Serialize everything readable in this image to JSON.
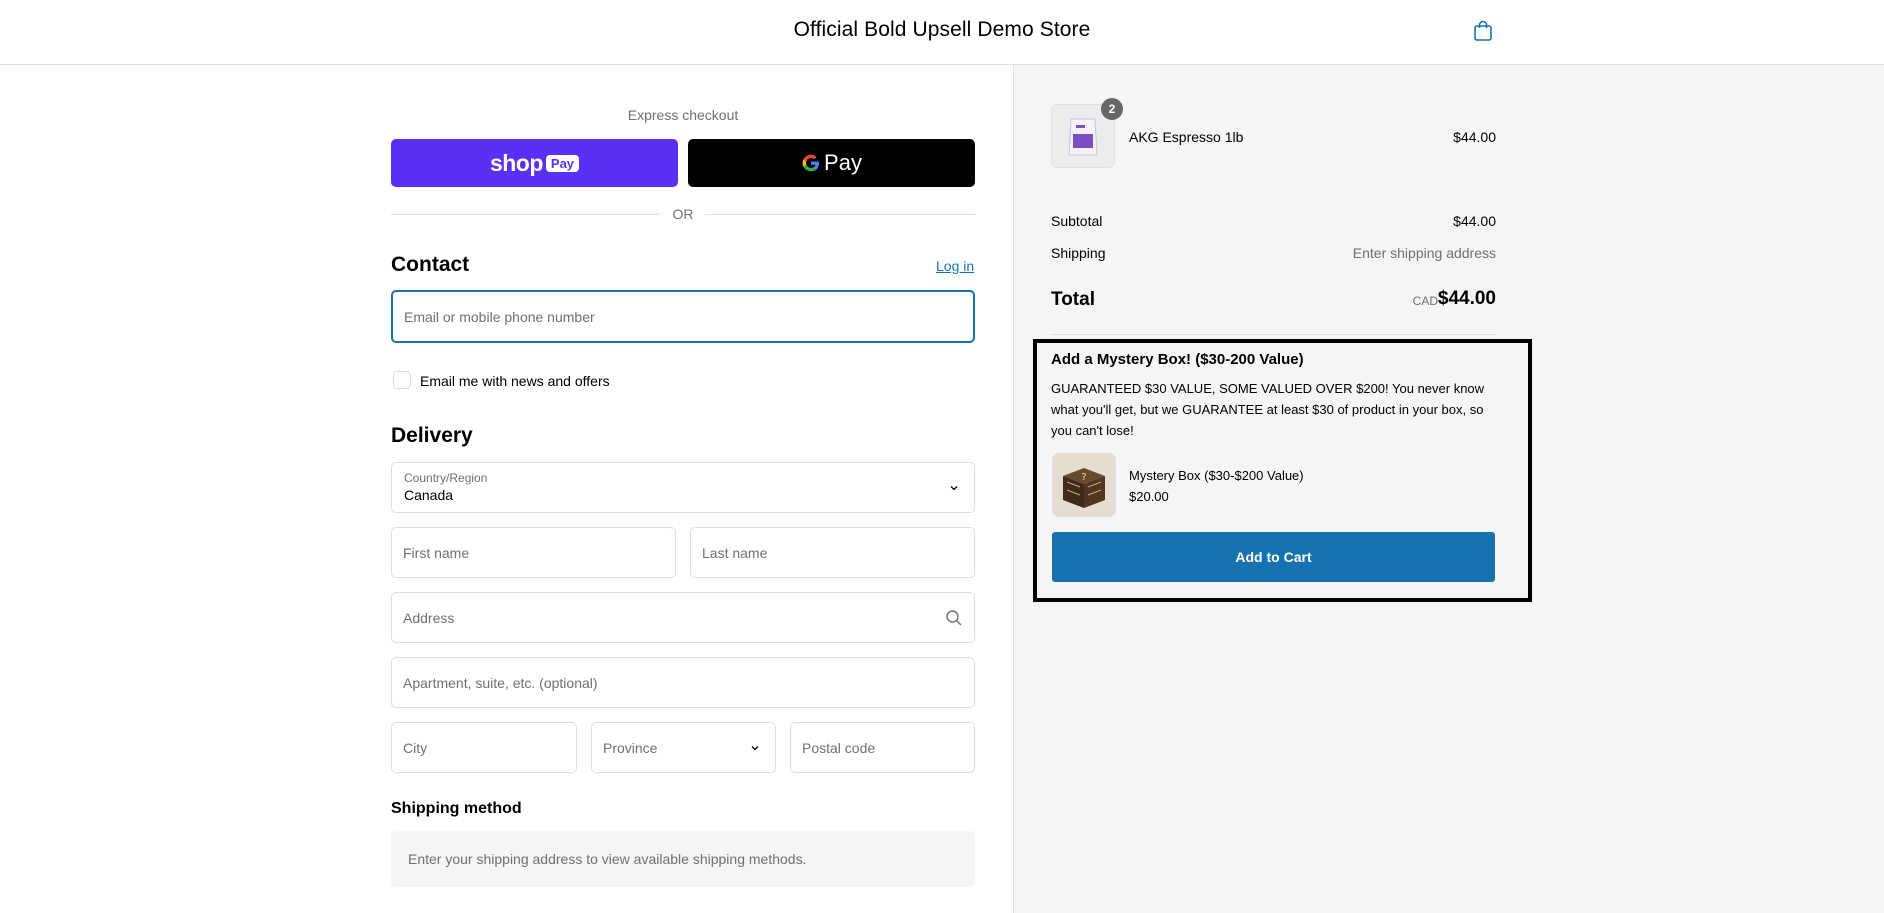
{
  "header": {
    "store_title": "Official Bold Upsell Demo Store",
    "cart_icon": "shopping-bag-icon"
  },
  "express": {
    "label": "Express checkout",
    "shoppay_text": "shop",
    "shoppay_pill": "Pay",
    "gpay_text": "Pay",
    "or_text": "OR"
  },
  "contact": {
    "title": "Contact",
    "login_link": "Log in",
    "email_placeholder": "Email or mobile phone number",
    "news_checkbox_label": "Email me with news and offers"
  },
  "delivery": {
    "title": "Delivery",
    "country_label": "Country/Region",
    "country_value": "Canada",
    "first_name_placeholder": "First name",
    "last_name_placeholder": "Last name",
    "address_placeholder": "Address",
    "apartment_placeholder": "Apartment, suite, etc. (optional)",
    "city_placeholder": "City",
    "province_placeholder": "Province",
    "postal_placeholder": "Postal code"
  },
  "shipping_method": {
    "title": "Shipping method",
    "info": "Enter your shipping address to view available shipping methods."
  },
  "order": {
    "item": {
      "name": "AKG Espresso 1lb",
      "price": "$44.00",
      "quantity": "2"
    },
    "subtotal_label": "Subtotal",
    "subtotal_value": "$44.00",
    "shipping_label": "Shipping",
    "shipping_value": "Enter shipping address",
    "total_label": "Total",
    "total_currency": "CAD",
    "total_value": "$44.00"
  },
  "upsell": {
    "title": "Add a Mystery Box! ($30-200 Value)",
    "description": "GUARANTEED $30 VALUE, SOME VALUED OVER $200! You never know what you'll get, but we GUARANTEE at least $30 of product in your box, so you can't lose!",
    "product_name": "Mystery Box ($30-$200 Value)",
    "product_price": "$20.00",
    "button_label": "Add to Cart"
  },
  "colors": {
    "shoppay": "#5a31f4",
    "accent": "#1773b0",
    "sidebar_bg": "#f5f5f5"
  }
}
